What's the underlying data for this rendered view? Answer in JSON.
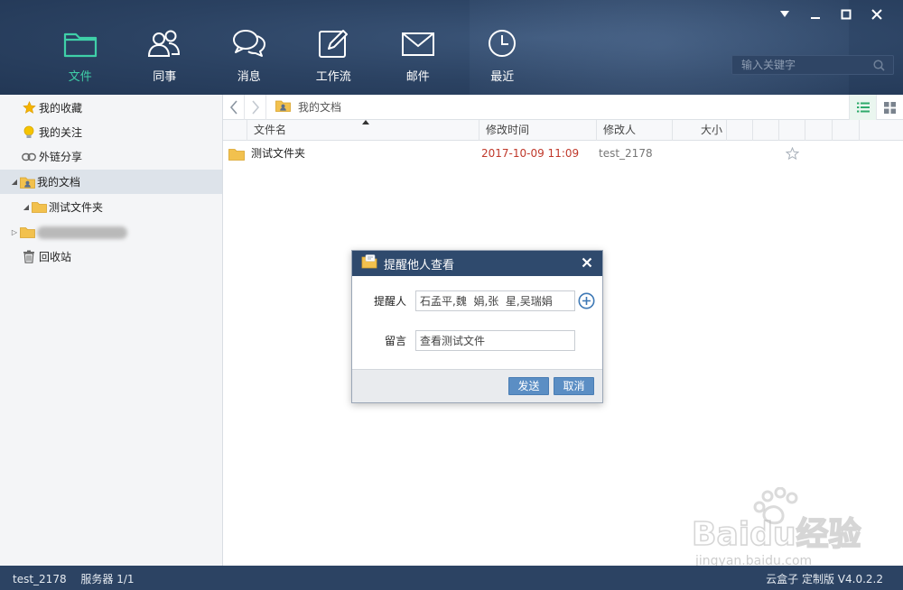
{
  "header": {
    "nav": [
      {
        "label": "文件",
        "icon": "folder-icon",
        "active": true
      },
      {
        "label": "同事",
        "icon": "colleagues-icon",
        "active": false
      },
      {
        "label": "消息",
        "icon": "chat-icon",
        "active": false
      },
      {
        "label": "工作流",
        "icon": "edit-icon",
        "active": false
      },
      {
        "label": "邮件",
        "icon": "mail-icon",
        "active": false
      },
      {
        "label": "最近",
        "icon": "clock-icon",
        "active": false
      }
    ],
    "search_placeholder": "输入关键字"
  },
  "sidebar": {
    "items": [
      {
        "label": "我的收藏",
        "icon": "star-icon"
      },
      {
        "label": "我的关注",
        "icon": "bulb-icon"
      },
      {
        "label": "外链分享",
        "icon": "link-icon"
      },
      {
        "label": "我的文档",
        "icon": "my-docs-icon"
      },
      {
        "label": "测试文件夹",
        "icon": "folder-icon"
      },
      {
        "label": "",
        "icon": "folder-icon"
      },
      {
        "label": "回收站",
        "icon": "trash-icon"
      }
    ]
  },
  "breadcrumb": {
    "label": "我的文档"
  },
  "table": {
    "columns": [
      "文件名",
      "修改时间",
      "修改人",
      "大小"
    ],
    "rows": [
      {
        "name": "测试文件夹",
        "modified": "2017-10-09 11:09",
        "modifier": "test_2178",
        "size": ""
      }
    ]
  },
  "dialog": {
    "title": "提醒他人查看",
    "recipients_label": "提醒人",
    "recipients_value": "石孟平,魏  娟,张  星,吴瑞娟",
    "message_label": "留言",
    "message_value": "查看测试文件",
    "send_label": "发送",
    "cancel_label": "取消"
  },
  "status": {
    "user": "test_2178",
    "server": "服务器 1/1",
    "version": "云盒子 定制版 V4.0.2.2"
  },
  "watermark": {
    "brand": "Baidu经验",
    "url": "jingyan.baidu.com"
  },
  "colors": {
    "header_bg": "#2b4262",
    "active_nav": "#3fd0a8",
    "date_red": "#c0392b",
    "button_blue": "#5b8ec4",
    "dialog_title_bg": "#2f4a6d"
  }
}
